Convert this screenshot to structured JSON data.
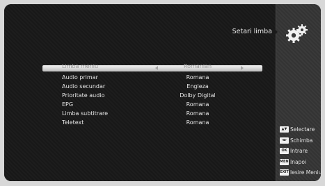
{
  "screen": {
    "title": "Setari limba"
  },
  "menu": {
    "rows": [
      {
        "label": "Limba meniu",
        "value": "Romanian"
      },
      {
        "label": "Audio primar",
        "value": "Romana"
      },
      {
        "label": "Audio secundar",
        "value": "Engleza"
      },
      {
        "label": "Prioritate audio",
        "value": "Dolby Digital"
      },
      {
        "label": "EPG",
        "value": "Romana"
      },
      {
        "label": "Limba subtitrare",
        "value": "Romana"
      },
      {
        "label": "Teletext",
        "value": "Romana"
      }
    ]
  },
  "legend": {
    "items": [
      {
        "key": "▲▼",
        "label": "Selectare"
      },
      {
        "key": "◄►",
        "label": "Schimba"
      },
      {
        "key": "OK",
        "label": "Intrare"
      },
      {
        "key": "MENU",
        "label": "Inapoi"
      },
      {
        "key": "EXIT",
        "label": "Iesire Meniu"
      }
    ]
  },
  "colors": {
    "background": "#1b1b1b",
    "selected_row": "#e6e6e6",
    "text": "#e8e8e8"
  },
  "icons": [
    "gears-icon"
  ]
}
